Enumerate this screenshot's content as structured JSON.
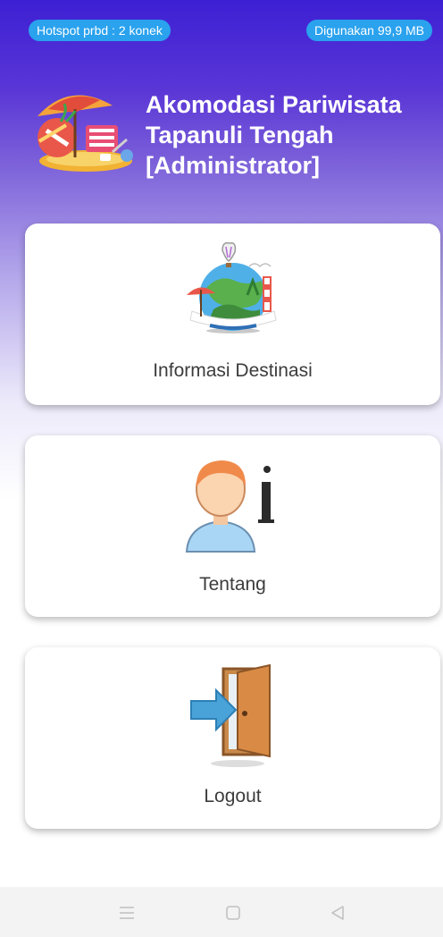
{
  "status_bar": {
    "hotspot_text": "Hotspot prbd : 2 konek",
    "usage_text": "Digunakan 99,9 MB"
  },
  "header": {
    "title_line1": "Akomodasi Pariwisata",
    "title_line2": "Tapanuli Tengah",
    "title_line3": "[Administrator]",
    "logo_icon": "beach-chair-umbrella-icon"
  },
  "menu": [
    {
      "label": "Informasi Destinasi",
      "icon": "travel-globe-icon"
    },
    {
      "label": "Tentang",
      "icon": "user-info-icon"
    },
    {
      "label": "Logout",
      "icon": "exit-door-icon"
    }
  ],
  "nav_bar": {
    "menu_icon": "menu-icon",
    "home_icon": "home-square-icon",
    "back_icon": "back-triangle-icon"
  },
  "colors": {
    "header_gradient_top": "#3d20d4",
    "status_pill": "#2aa2ee",
    "card_text": "#3c3c3c"
  }
}
